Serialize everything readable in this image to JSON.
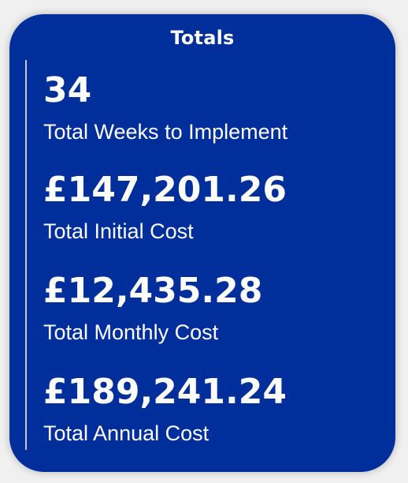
{
  "card": {
    "title": "Totals",
    "metrics": [
      {
        "value": "34",
        "label": "Total Weeks to Implement"
      },
      {
        "value": "£147,201.26",
        "label": "Total Initial Cost"
      },
      {
        "value": "£12,435.28",
        "label": "Total Monthly Cost"
      },
      {
        "value": "£189,241.24",
        "label": "Total Annual Cost"
      }
    ]
  },
  "colors": {
    "card_background": "#002f9c",
    "text": "#ffffff",
    "divider": "#c8c8d0"
  }
}
